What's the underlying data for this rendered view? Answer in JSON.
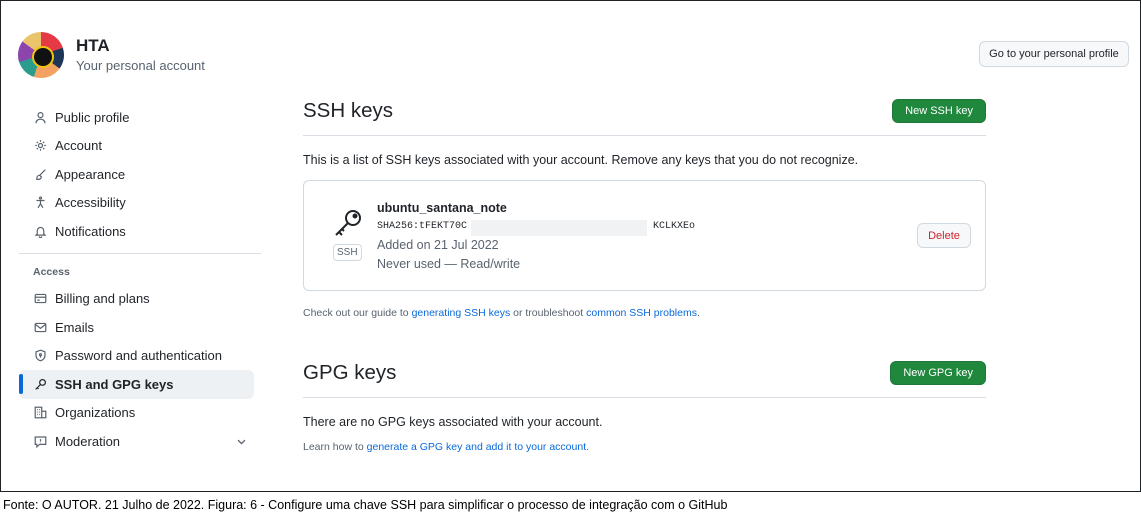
{
  "account": {
    "name": "HTA",
    "subtitle": "Your personal account",
    "profile_button": "Go to your personal profile"
  },
  "sidebar": {
    "items": [
      {
        "label": "Public profile",
        "icon": "person-icon"
      },
      {
        "label": "Account",
        "icon": "gear-icon"
      },
      {
        "label": "Appearance",
        "icon": "paintbrush-icon"
      },
      {
        "label": "Accessibility",
        "icon": "accessibility-icon"
      },
      {
        "label": "Notifications",
        "icon": "bell-icon"
      }
    ],
    "access_heading": "Access",
    "access_items": [
      {
        "label": "Billing and plans",
        "icon": "credit-card-icon"
      },
      {
        "label": "Emails",
        "icon": "mail-icon"
      },
      {
        "label": "Password and authentication",
        "icon": "shield-lock-icon"
      },
      {
        "label": "SSH and GPG keys",
        "icon": "key-icon",
        "active": true
      },
      {
        "label": "Organizations",
        "icon": "organization-icon"
      },
      {
        "label": "Moderation",
        "icon": "report-icon"
      }
    ]
  },
  "ssh": {
    "title": "SSH keys",
    "new_button": "New SSH key",
    "intro": "This is a list of SSH keys associated with your account. Remove any keys that you do not recognize.",
    "key": {
      "name": "ubuntu_santana_note",
      "fingerprint_prefix": "SHA256:tFEKT70C",
      "fingerprint_suffix": "KCLKXEo",
      "added": "Added on 21 Jul 2022",
      "usage": "Never used — Read/write",
      "type_label": "SSH",
      "delete_button": "Delete"
    },
    "guide_prefix": "Check out our guide to ",
    "guide_link1": "generating SSH keys",
    "guide_middle": " or troubleshoot ",
    "guide_link2": "common SSH problems",
    "guide_suffix": "."
  },
  "gpg": {
    "title": "GPG keys",
    "new_button": "New GPG key",
    "empty": "There are no GPG keys associated with your account.",
    "note_prefix": "Learn how to ",
    "note_link": "generate a GPG key and add it to your account",
    "note_suffix": "."
  },
  "caption": "Fonte: O AUTOR. 21 Julho de 2022. Figura: 6 - Configure uma chave SSH para simplificar o processo de integração com o GitHub",
  "colors": {
    "primary_green": "#1f883d",
    "link_blue": "#0969da",
    "danger_red": "#cf222e",
    "active_indicator": "#0969da"
  }
}
